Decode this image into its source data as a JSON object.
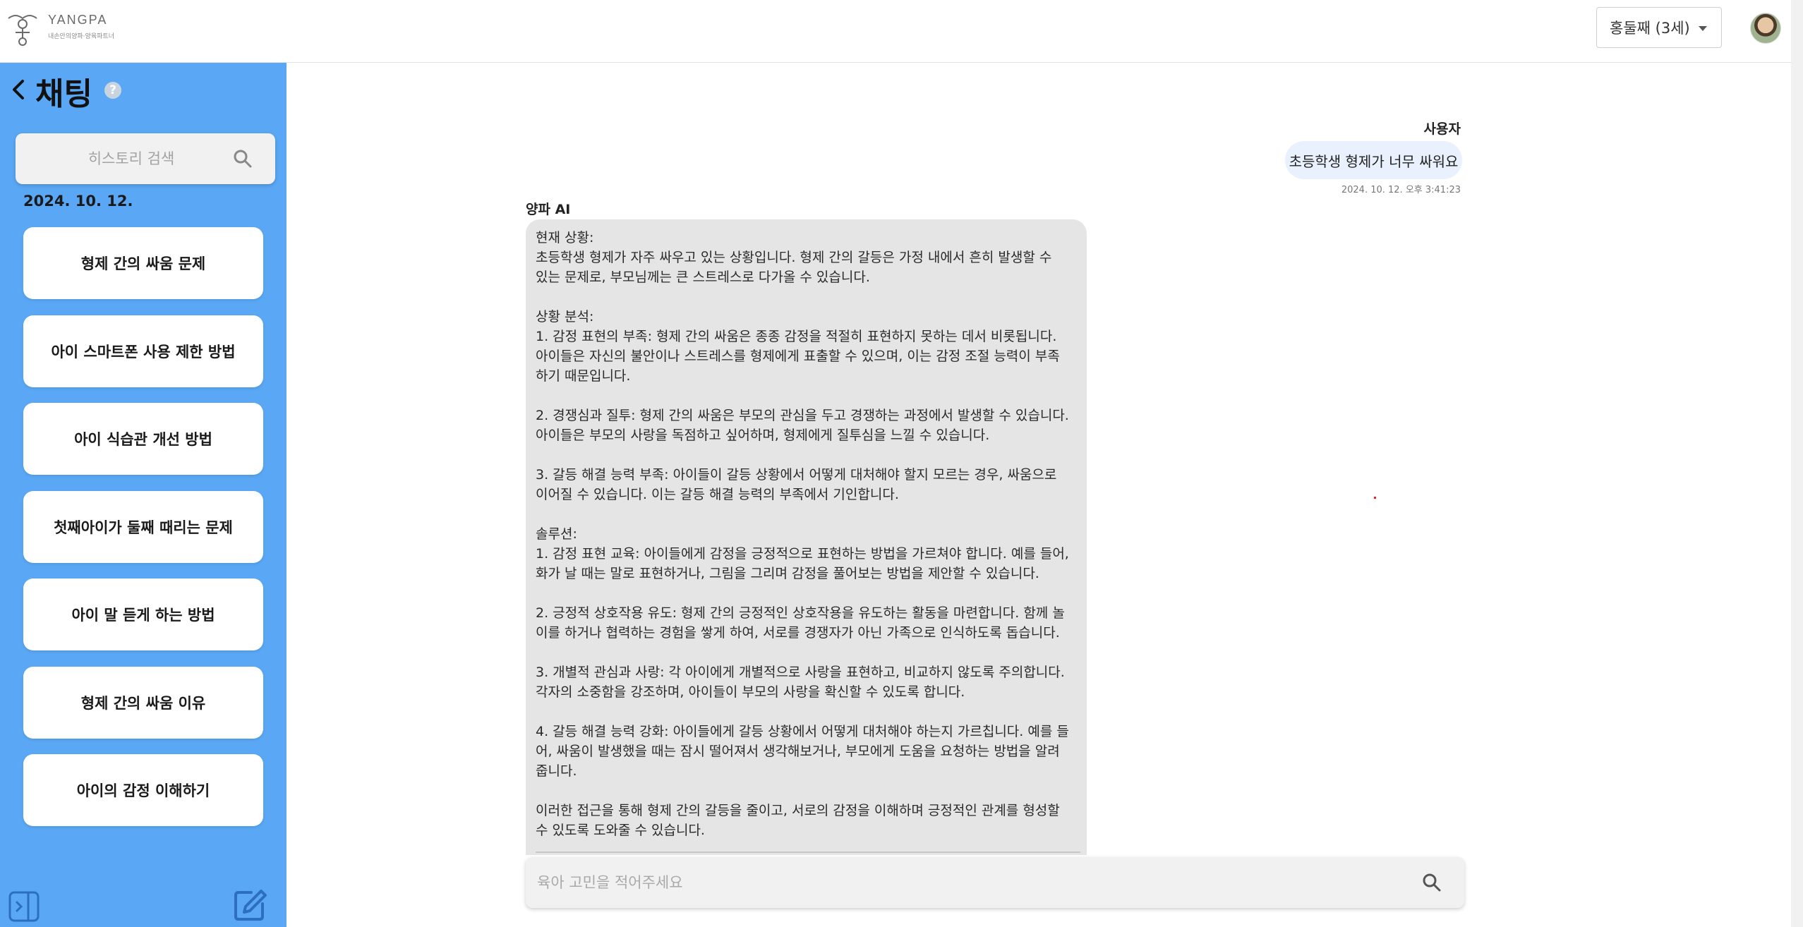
{
  "header": {
    "logo_title": "YANGPA",
    "logo_subtitle": "내손안의양파·양육파트너",
    "child_select_value": "홍둘째 (3세)"
  },
  "sidebar": {
    "title": "채팅",
    "help_glyph": "?",
    "search_placeholder": "히스토리 검색",
    "date": "2024. 10. 12.",
    "items": [
      "형제 간의 싸움 문제",
      "아이 스마트폰 사용 제한 방법",
      "아이 식습관 개선 방법",
      "첫째아이가 둘째 때리는 문제",
      "아이 말 듣게 하는 방법",
      "형제 간의 싸움 이유",
      "아이의 감정 이해하기"
    ]
  },
  "chat": {
    "user_name": "사용자",
    "user_message": "초등학생 형제가 너무 싸워요",
    "user_time": "2024. 10. 12. 오후 3:41:23",
    "ai_name": "양파 AI",
    "ai_message": "현재 상황:\n초등학생 형제가 자주 싸우고 있는 상황입니다. 형제 간의 갈등은 가정 내에서 흔히 발생할 수\n있는 문제로, 부모님께는 큰 스트레스로 다가올 수 있습니다.\n\n상황 분석:\n1. 감정 표현의 부족: 형제 간의 싸움은 종종 감정을 적절히 표현하지 못하는 데서 비롯됩니다.\n아이들은 자신의 불안이나 스트레스를 형제에게 표출할 수 있으며, 이는 감정 조절 능력이 부족\n하기 때문입니다.\n\n2. 경쟁심과 질투: 형제 간의 싸움은 부모의 관심을 두고 경쟁하는 과정에서 발생할 수 있습니다.\n아이들은 부모의 사랑을 독점하고 싶어하며, 형제에게 질투심을 느낄 수 있습니다.\n\n3. 갈등 해결 능력 부족: 아이들이 갈등 상황에서 어떻게 대처해야 할지 모르는 경우, 싸움으로\n이어질 수 있습니다. 이는 갈등 해결 능력의 부족에서 기인합니다.\n\n솔루션:\n1. 감정 표현 교육: 아이들에게 감정을 긍정적으로 표현하는 방법을 가르쳐야 합니다. 예를 들어,\n화가 날 때는 말로 표현하거나, 그림을 그리며 감정을 풀어보는 방법을 제안할 수 있습니다.\n\n2. 긍정적 상호작용 유도: 형제 간의 긍정적인 상호작용을 유도하는 활동을 마련합니다. 함께 놀\n이를 하거나 협력하는 경험을 쌓게 하여, 서로를 경쟁자가 아닌 가족으로 인식하도록 돕습니다.\n\n3. 개별적 관심과 사랑: 각 아이에게 개별적으로 사랑을 표현하고, 비교하지 않도록 주의합니다.\n각자의 소중함을 강조하며, 아이들이 부모의 사랑을 확신할 수 있도록 합니다.\n\n4. 갈등 해결 능력 강화: 아이들에게 갈등 상황에서 어떻게 대처해야 하는지 가르칩니다. 예를 들\n어, 싸움이 발생했을 때는 잠시 떨어져서 생각해보거나, 부모에게 도움을 요청하는 방법을 알려\n줍니다.\n\n이러한 접근을 통해 형제 간의 갈등을 줄이고, 서로의 감정을 이해하며 긍정적인 관계를 형성할\n수 있도록 도와줄 수 있습니다.",
    "composer_placeholder": "육아 고민을 적어주세요"
  },
  "colors": {
    "sidebar_bg": "#5aa8f5",
    "ai_bubble_bg": "#e5e5e5",
    "user_bubble_bg": "#e8f1fd"
  },
  "icons": [
    "logo-icon",
    "back-chevron-icon",
    "help-icon",
    "search-icon",
    "caret-down-icon",
    "sidebar-toggle-icon",
    "edit-icon"
  ]
}
